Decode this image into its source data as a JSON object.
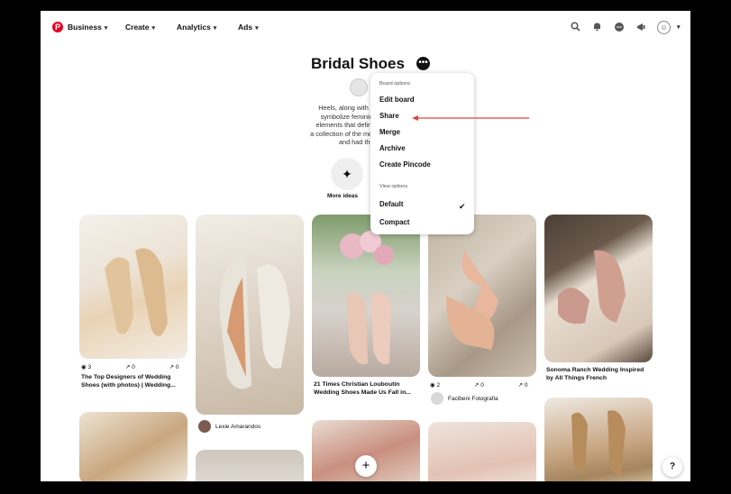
{
  "nav": {
    "logo_glyph": "P",
    "items": [
      {
        "label": "Business"
      },
      {
        "label": "Create"
      },
      {
        "label": "Analytics"
      },
      {
        "label": "Ads"
      }
    ],
    "icons": [
      "search-icon",
      "bell-icon",
      "messages-icon",
      "megaphone-icon"
    ]
  },
  "board": {
    "title": "Bridal Shoes",
    "description_lines": [
      "Heels, along with a few other sh",
      "symbolize femininity. Not surpr",
      "elements that define the style and",
      "a collection of the most amazing we               n",
      "and had the pleas"
    ],
    "more_ideas_label": "More ideas"
  },
  "menu": {
    "board_options_heading": "Board options",
    "edit_board": "Edit board",
    "share": "Share",
    "merge": "Merge",
    "archive": "Archive",
    "create_pincode": "Create Pincode",
    "view_options_heading": "View options",
    "default": "Default",
    "compact": "Compact",
    "selected_view": "Default"
  },
  "annotation": {
    "arrow_color": "#e0463a"
  },
  "pins": {
    "p1": {
      "saves": "3",
      "reactions": "0",
      "shares": "0",
      "title": "The Top Designers of Wedding Shoes (with photos) | Wedding..."
    },
    "p2": {
      "author": "Lexie Amarandos"
    },
    "p3": {
      "title": "21 Times Christian Louboutin Wedding Shoes Made Us Fall in..."
    },
    "p4": {
      "saves": "2",
      "reactions": "0",
      "shares": "0",
      "author": "Facibeni Fotografia"
    },
    "p5": {
      "title": "Sonoma Ranch Wedding Inspired by All Things French"
    }
  },
  "buttons": {
    "add": "+",
    "help": "?"
  }
}
